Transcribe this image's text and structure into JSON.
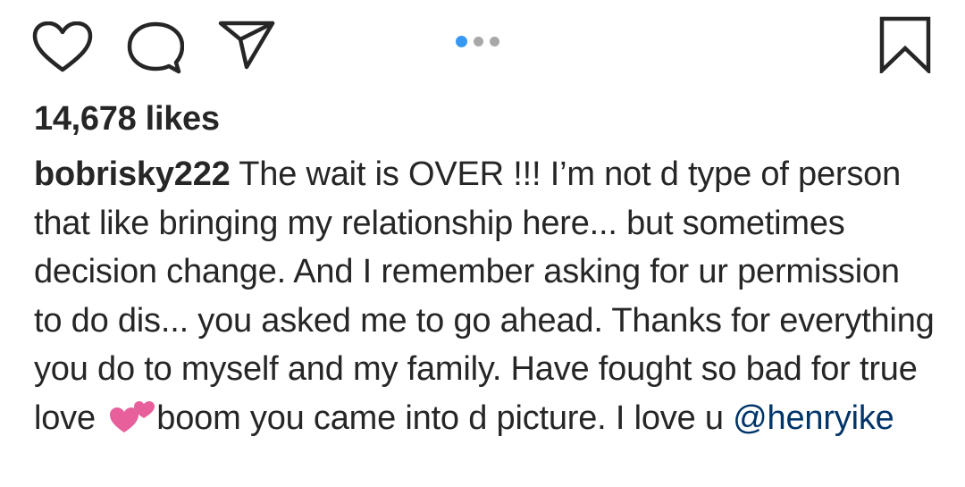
{
  "icons": {
    "like": "heart-outline-icon",
    "comment": "speech-bubble-icon",
    "share": "paper-plane-icon",
    "save": "bookmark-outline-icon",
    "emoji": "two-hearts-emoji"
  },
  "carousel": {
    "total": 3,
    "active_index": 0
  },
  "post": {
    "likes": "14,678 likes",
    "username": "bobrisky222",
    "caption_part1": " The wait is OVER !!! I’m not d type of person that like bringing my relationship here... but sometimes decision change. And I remember asking for ur permission to do dis... you asked me to go ahead. Thanks for everything you do to myself and my family. Have fought so bad for true love ",
    "caption_part2": "boom you came into d picture. I love u ",
    "mention": "@henryike"
  },
  "colors": {
    "text": "#262626",
    "carousel_active": "#3897f0",
    "carousel_inactive": "#a8a8a8",
    "mention": "#003569",
    "heart_emoji": "#e8609b"
  }
}
